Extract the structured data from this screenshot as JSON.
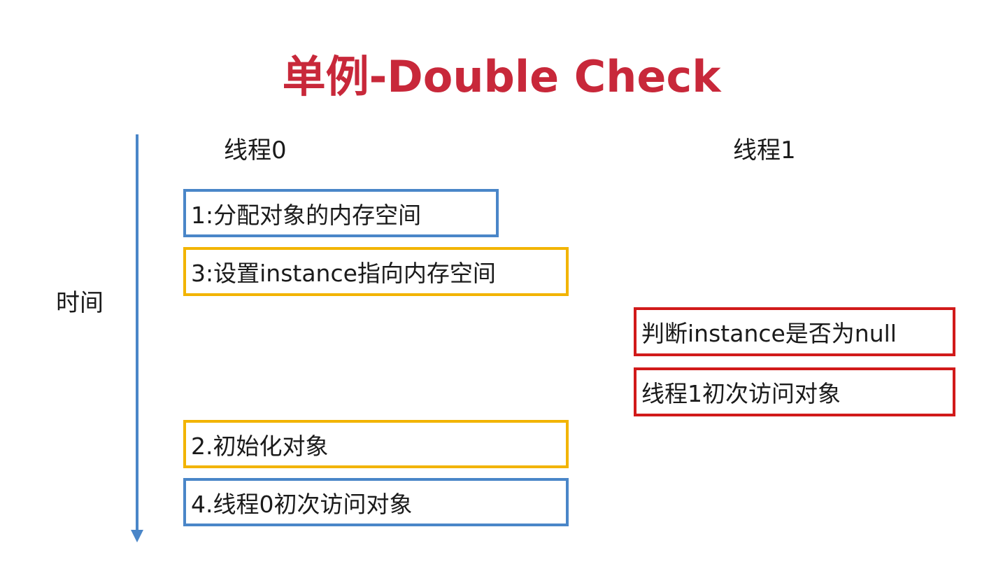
{
  "title": "单例-Double Check",
  "axis": {
    "label": "时间",
    "color": "#4a86c8"
  },
  "threads": [
    {
      "label": "线程0"
    },
    {
      "label": "线程1"
    }
  ],
  "steps": {
    "allocate": {
      "text": "1:分配对象的内存空间",
      "thread": 0,
      "color": "#4a86c8"
    },
    "set_instance": {
      "text": "3:设置instance指向内存空间",
      "thread": 0,
      "color": "#f2b400"
    },
    "check_null": {
      "text": "判断instance是否为null",
      "thread": 1,
      "color": "#d11a1a"
    },
    "thread1_access": {
      "text": "线程1初次访问对象",
      "thread": 1,
      "color": "#d11a1a"
    },
    "initialize": {
      "text": "2.初始化对象",
      "thread": 0,
      "color": "#f2b400"
    },
    "thread0_access": {
      "text": "4.线程0初次访问对象",
      "thread": 0,
      "color": "#4a86c8"
    }
  },
  "colors": {
    "title": "#c8283a",
    "blue": "#4a86c8",
    "yellow": "#f2b400",
    "red": "#d11a1a"
  }
}
